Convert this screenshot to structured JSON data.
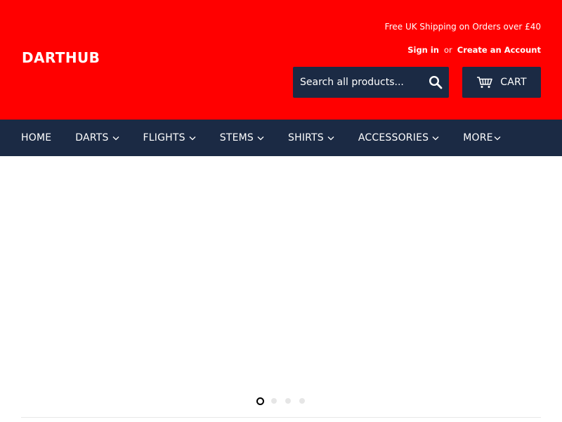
{
  "header": {
    "logo": "DARTHUB",
    "shipping_note": "Free UK Shipping on Orders over £40",
    "sign_in": "Sign in",
    "or": "or",
    "create_account": "Create an Account",
    "search_placeholder": "Search all products...",
    "cart_label": "CART"
  },
  "nav": {
    "items": [
      {
        "label": "HOME",
        "has_dropdown": false
      },
      {
        "label": "DARTS",
        "has_dropdown": true
      },
      {
        "label": "FLIGHTS",
        "has_dropdown": true
      },
      {
        "label": "STEMS",
        "has_dropdown": true
      },
      {
        "label": "SHIRTS",
        "has_dropdown": true
      },
      {
        "label": "ACCESSORIES",
        "has_dropdown": true
      },
      {
        "label": "MORE",
        "has_dropdown": true
      }
    ]
  },
  "slideshow": {
    "slide_count": 4,
    "active_index": 0
  },
  "colors": {
    "header_bg": "#ff0000",
    "nav_bg": "#1b2a44",
    "text_light": "#ffffff"
  },
  "icons": {
    "search": "search-icon",
    "cart": "cart-icon",
    "dropdown": "chevron-down-icon"
  }
}
